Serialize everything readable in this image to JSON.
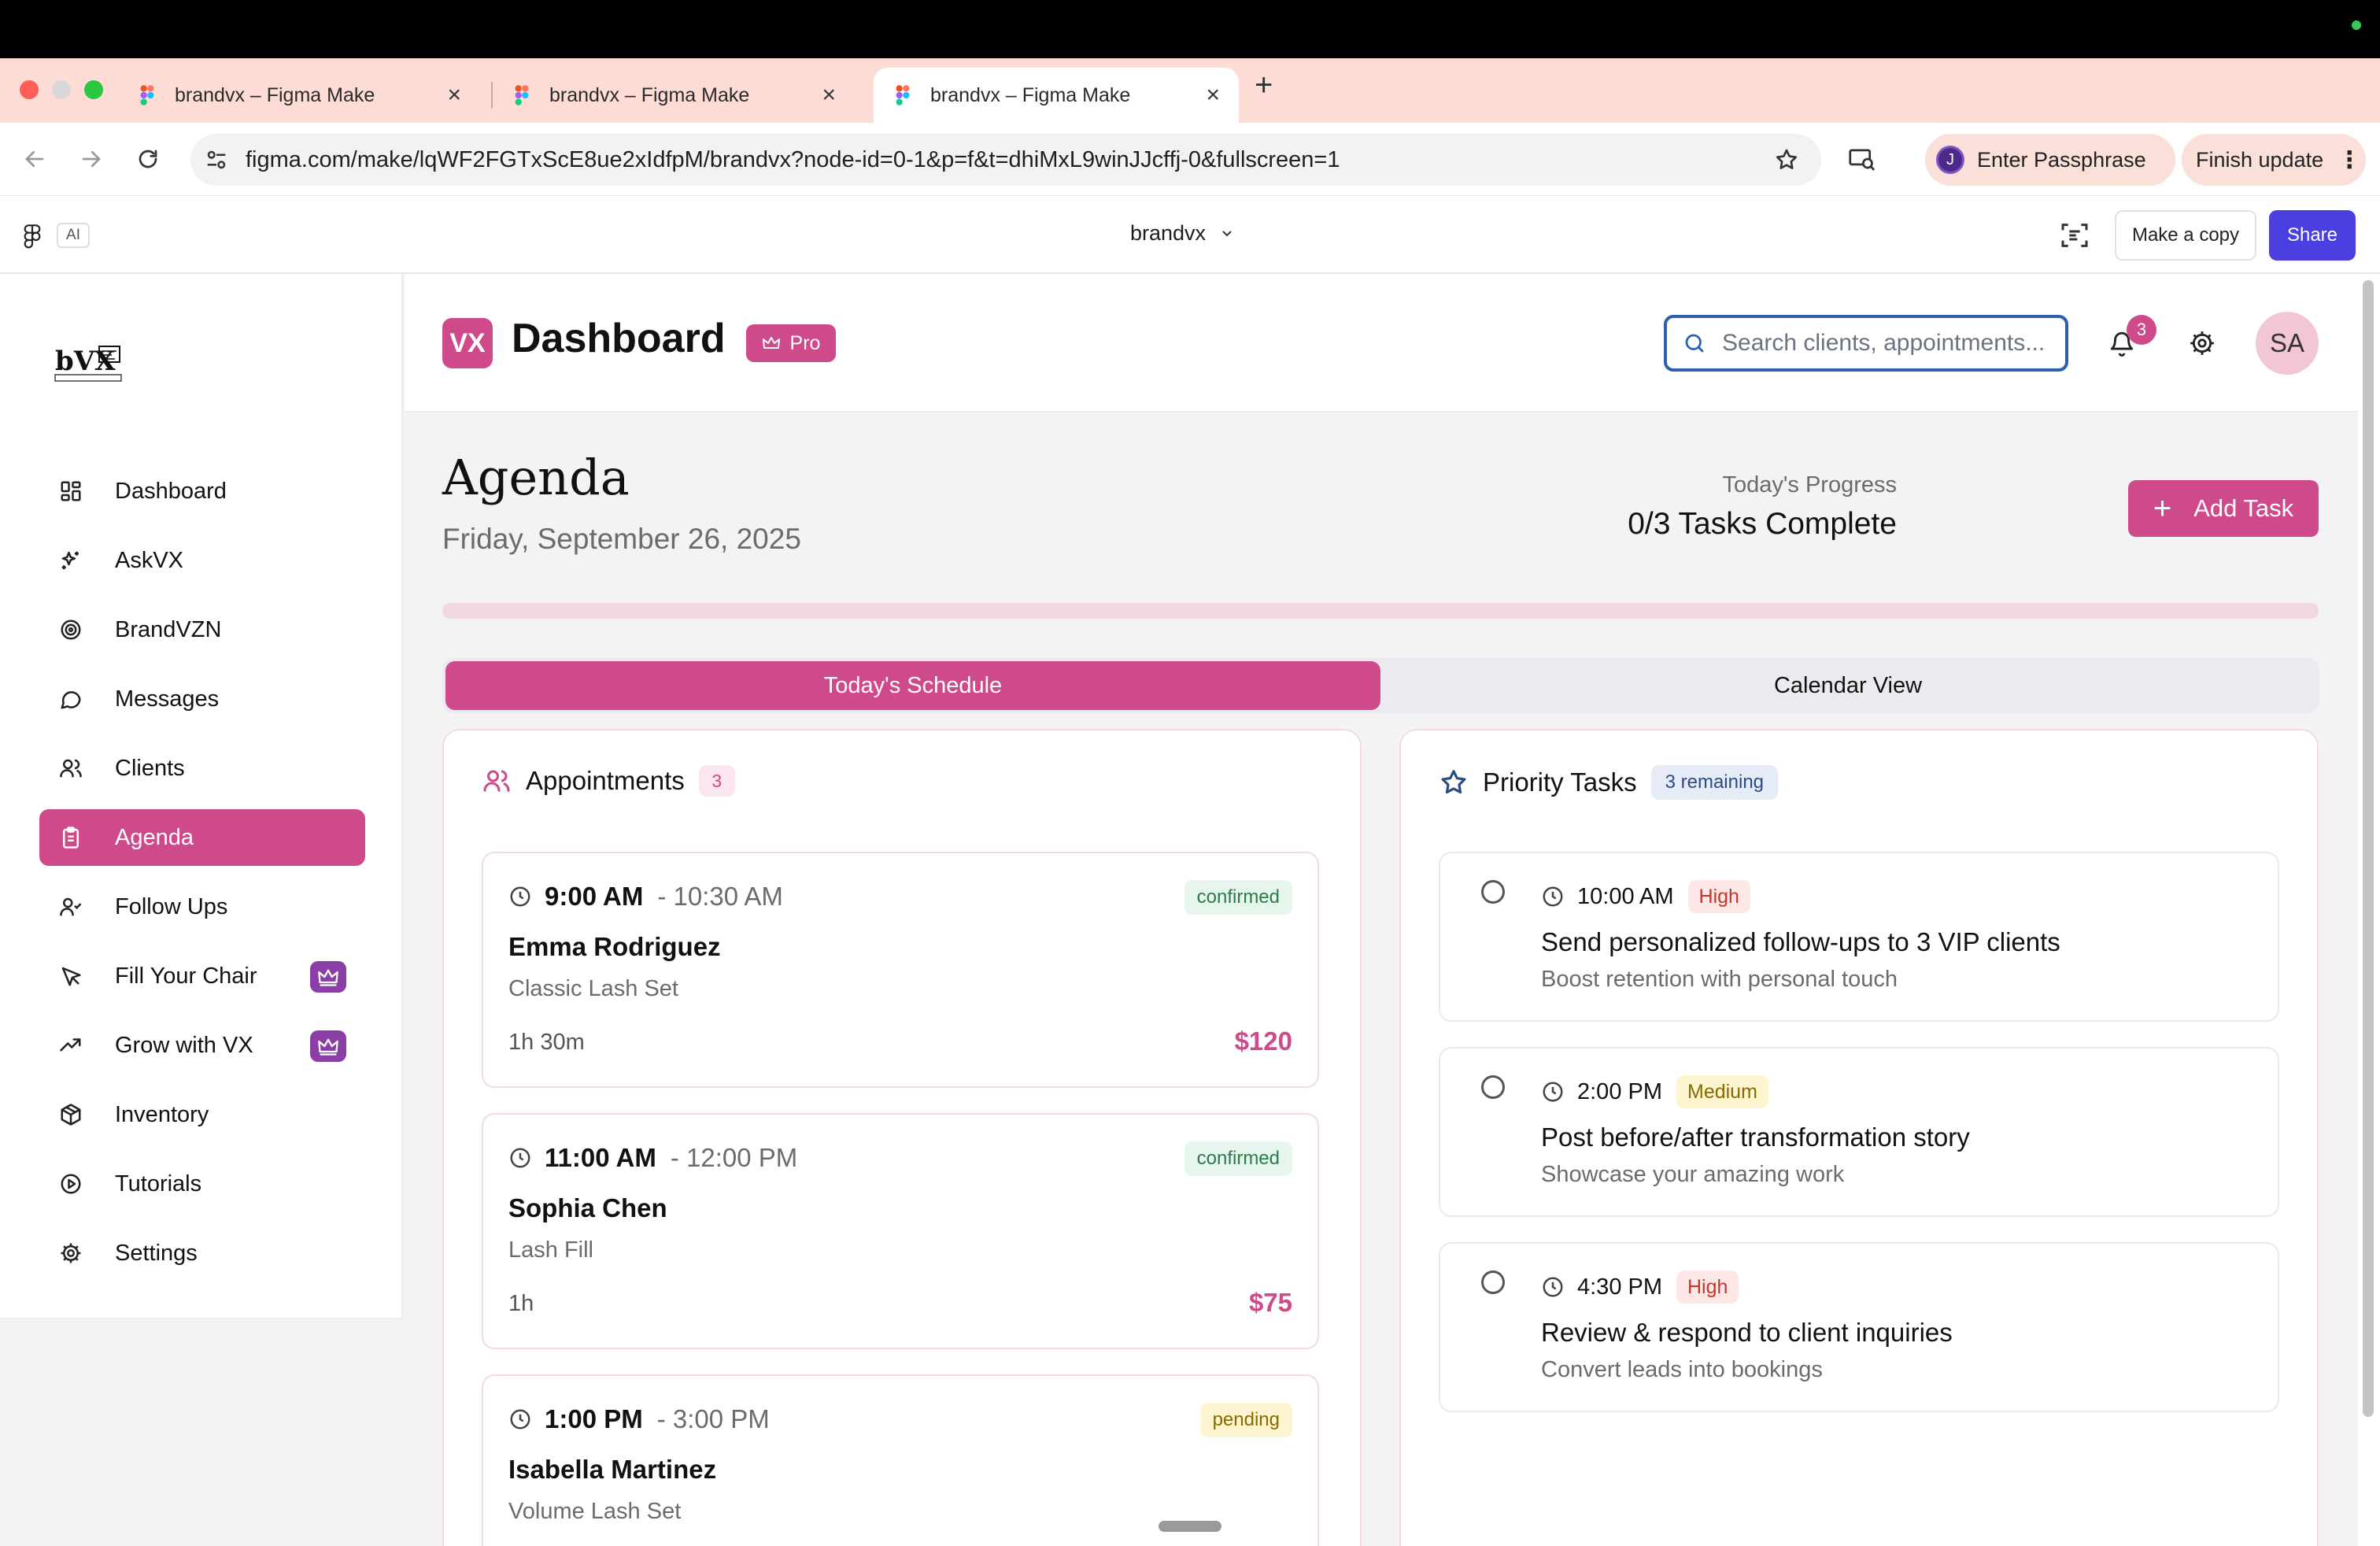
{
  "browser": {
    "tabs": [
      {
        "title": "brandvx – Figma Make",
        "active": false
      },
      {
        "title": "brandvx – Figma Make",
        "active": false
      },
      {
        "title": "brandvx – Figma Make",
        "active": true
      }
    ],
    "new_tab": "+",
    "url": "figma.com/make/lqWF2FGTxScE8ue2xIdfpM/brandvx?node-id=0-1&p=f&t=dhiMxL9winJJcffj-0&fullscreen=1",
    "passphrase_avatar": "J",
    "passphrase_label": "Enter Passphrase",
    "update_label": "Finish update",
    "kebab": "⋮"
  },
  "figma": {
    "ai_label": "AI",
    "project_name": "brandvx",
    "make_copy_label": "Make a copy",
    "share_label": "Share"
  },
  "sidebar": {
    "logo_text": "bVX",
    "items": [
      {
        "label": "Dashboard",
        "icon": "grid-icon"
      },
      {
        "label": "AskVX",
        "icon": "sparkles-icon"
      },
      {
        "label": "BrandVZN",
        "icon": "target-icon"
      },
      {
        "label": "Messages",
        "icon": "chat-icon"
      },
      {
        "label": "Clients",
        "icon": "users-icon"
      },
      {
        "label": "Agenda",
        "icon": "clipboard-icon",
        "active": true
      },
      {
        "label": "Follow Ups",
        "icon": "user-check-icon"
      },
      {
        "label": "Fill Your Chair",
        "icon": "cursor-icon",
        "pro": true
      },
      {
        "label": "Grow with VX",
        "icon": "trend-icon",
        "pro": true
      },
      {
        "label": "Inventory",
        "icon": "box-icon"
      },
      {
        "label": "Tutorials",
        "icon": "play-icon"
      },
      {
        "label": "Settings",
        "icon": "gear-icon"
      }
    ]
  },
  "header": {
    "logo": "VX",
    "title": "Dashboard",
    "pro_label": "Pro",
    "search_placeholder": "Search clients, appointments...",
    "notification_count": "3",
    "avatar_initials": "SA"
  },
  "agenda": {
    "title": "Agenda",
    "date": "Friday, September 26, 2025",
    "progress_label": "Today's Progress",
    "progress_value": "0/3 Tasks Complete",
    "progress_fraction": 0,
    "add_task_icon": "+",
    "add_task_label": "Add Task",
    "tabs": [
      {
        "label": "Today's Schedule",
        "active": true
      },
      {
        "label": "Calendar View",
        "active": false
      }
    ]
  },
  "appointments": {
    "title": "Appointments",
    "count": "3",
    "items": [
      {
        "start": "9:00 AM",
        "end": "- 10:30 AM",
        "status": "confirmed",
        "client": "Emma Rodriguez",
        "service": "Classic Lash Set",
        "duration": "1h 30m",
        "price": "$120"
      },
      {
        "start": "11:00 AM",
        "end": "- 12:00 PM",
        "status": "confirmed",
        "client": "Sophia Chen",
        "service": "Lash Fill",
        "duration": "1h",
        "price": "$75"
      },
      {
        "start": "1:00 PM",
        "end": "- 3:00 PM",
        "status": "pending",
        "client": "Isabella Martinez",
        "service": "Volume Lash Set",
        "duration": "",
        "price": ""
      }
    ]
  },
  "tasks": {
    "title": "Priority Tasks",
    "remaining": "3 remaining",
    "items": [
      {
        "time": "10:00 AM",
        "priority": "High",
        "title": "Send personalized follow-ups to 3 VIP clients",
        "description": "Boost retention with personal touch"
      },
      {
        "time": "2:00 PM",
        "priority": "Medium",
        "title": "Post before/after transformation story",
        "description": "Showcase your amazing work"
      },
      {
        "time": "4:30 PM",
        "priority": "High",
        "title": "Review & respond to client inquiries",
        "description": "Convert leads into bookings"
      }
    ]
  },
  "colors": {
    "accent": "#cf4a8b",
    "share": "#4b3fe0",
    "tabstrip": "#fcdcd4"
  }
}
